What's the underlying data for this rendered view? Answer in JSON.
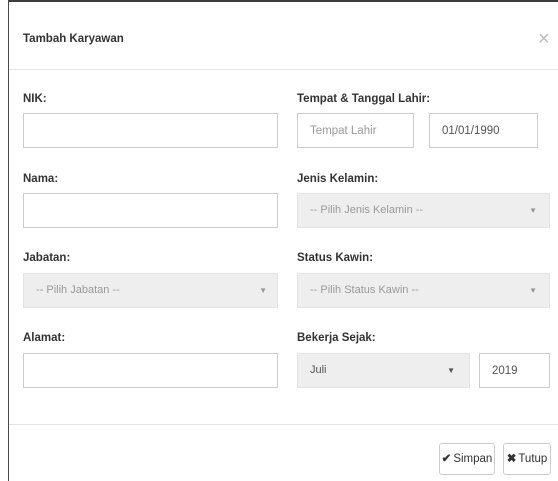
{
  "modal": {
    "title": "Tambah Karyawan",
    "close_icon": "×"
  },
  "form": {
    "nik": {
      "label": "NIK:",
      "value": ""
    },
    "ttl": {
      "label": "Tempat & Tanggal Lahir:",
      "place_placeholder": "Tempat Lahir",
      "date_value": "01/01/1990"
    },
    "nama": {
      "label": "Nama:",
      "value": ""
    },
    "jenis_kelamin": {
      "label": "Jenis Kelamin:",
      "selected": "-- Pilih Jenis Kelamin --"
    },
    "jabatan": {
      "label": "Jabatan:",
      "selected": "-- Pilih Jabatan --"
    },
    "status_kawin": {
      "label": "Status Kawin:",
      "selected": "-- Pilih Status Kawin --"
    },
    "alamat": {
      "label": "Alamat:",
      "value": ""
    },
    "bekerja_sejak": {
      "label": "Bekerja Sejak:",
      "month": "Juli",
      "year": "2019"
    }
  },
  "footer": {
    "save_icon": "✔",
    "save_label": "Simpan",
    "close_icon": "✖",
    "close_label": "Tutup"
  },
  "icons": {
    "caret": "▼"
  }
}
